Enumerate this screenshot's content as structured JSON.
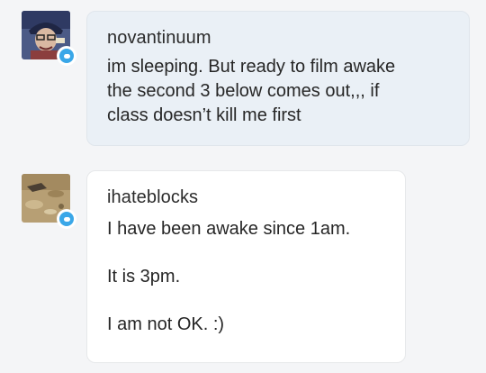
{
  "messages": [
    {
      "username": "novantinuum",
      "avatar": "cartoon-character-avatar",
      "lines": [
        "im sleeping. But ready to film awake",
        "the second 3 below comes out,,, if",
        "class doesn’t kill me first"
      ]
    },
    {
      "username": "ihateblocks",
      "avatar": "sand-photo-avatar",
      "paragraphs": [
        "I have been awake since 1am.",
        "It is 3pm.",
        "I am not OK. :)"
      ]
    }
  ],
  "colors": {
    "background": "#f4f5f7",
    "bubble_tinted": "#eaf0f6",
    "bubble_plain": "#ffffff",
    "badge": "#3aa7e8"
  }
}
